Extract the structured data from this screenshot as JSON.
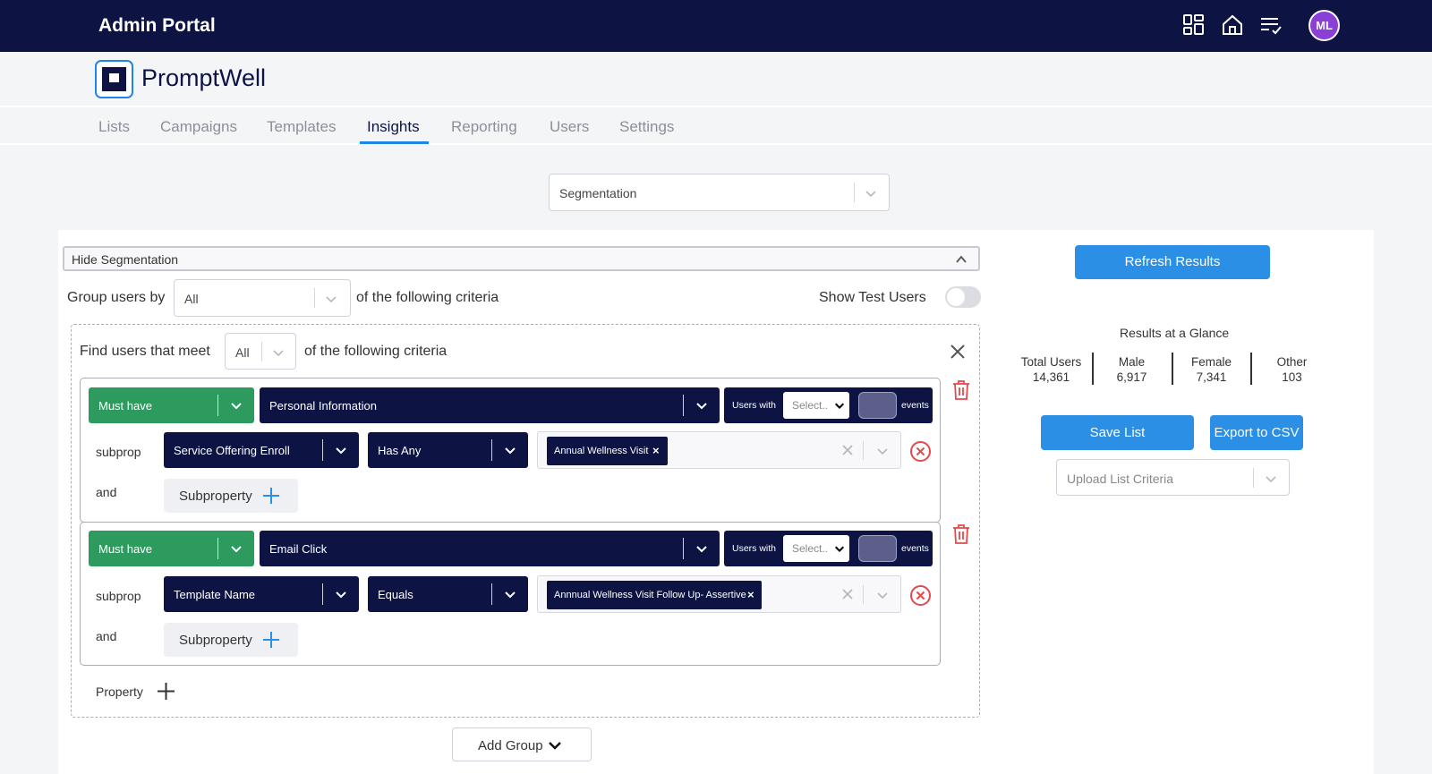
{
  "header": {
    "title": "Admin Portal",
    "avatar_initials": "ML"
  },
  "brand": {
    "name": "PromptWell"
  },
  "tabs": [
    {
      "label": "Lists"
    },
    {
      "label": "Campaigns"
    },
    {
      "label": "Templates"
    },
    {
      "label": "Insights",
      "active": true
    },
    {
      "label": "Reporting"
    },
    {
      "label": "Users"
    },
    {
      "label": "Settings"
    }
  ],
  "view_select": {
    "value": "Segmentation"
  },
  "segmentation": {
    "hide_label": "Hide Segmentation",
    "group_by_label": "Group users by",
    "group_by_value": "All",
    "criteria_suffix": "of the following criteria",
    "show_test_users_label": "Show Test Users",
    "find_label": "Find users that meet",
    "find_value": "All",
    "rules": [
      {
        "requirement": "Must have",
        "event": "Personal Information",
        "users_with": "Users with",
        "select_placeholder": "Select..",
        "events_label": "events",
        "subprop_label": "subprop",
        "subprop_field": "Service Offering Enroll",
        "operator": "Has Any",
        "chip": "Annual Wellness Visit",
        "and_label": "and",
        "subproperty_button": "Subproperty"
      },
      {
        "requirement": "Must have",
        "event": "Email Click",
        "users_with": "Users with",
        "select_placeholder": "Select..",
        "events_label": "events",
        "subprop_label": "subprop",
        "subprop_field": "Template Name",
        "operator": "Equals",
        "chip": "Annnual Wellness Visit Follow Up- Assertive",
        "and_label": "and",
        "subproperty_button": "Subproperty"
      }
    ],
    "property_label": "Property",
    "add_group_label": "Add Group"
  },
  "results": {
    "refresh_label": "Refresh Results",
    "glance_title": "Results at a Glance",
    "stats": [
      {
        "label": "Total Users",
        "value": "14,361"
      },
      {
        "label": "Male",
        "value": "6,917"
      },
      {
        "label": "Female",
        "value": "7,341"
      },
      {
        "label": "Other",
        "value": "103"
      }
    ],
    "save_label": "Save List",
    "export_label": "Export to CSV",
    "upload_placeholder": "Upload List Criteria"
  },
  "colors": {
    "navy": "#0d1444",
    "accent_blue": "#2b8fe5",
    "green": "#2e9b5e",
    "danger": "#e5484d"
  }
}
